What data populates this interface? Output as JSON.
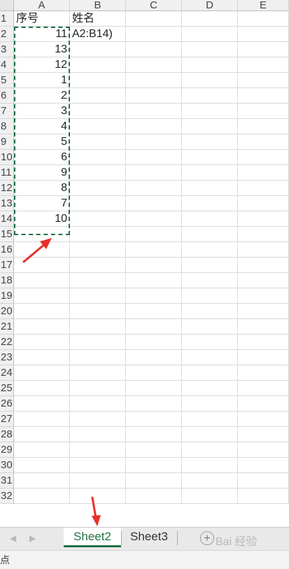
{
  "columns": [
    "A",
    "B",
    "C",
    "D",
    "E"
  ],
  "rows": [
    "1",
    "2",
    "3",
    "4",
    "5",
    "6",
    "7",
    "8",
    "9",
    "10",
    "11",
    "12",
    "13",
    "14",
    "15",
    "16",
    "17",
    "18",
    "19",
    "20",
    "21",
    "22",
    "23",
    "24",
    "25",
    "26",
    "27",
    "28",
    "29",
    "30",
    "31",
    "32"
  ],
  "headers": {
    "A": "序号",
    "B": "姓名"
  },
  "column_a_values": [
    "11",
    "13",
    "12",
    "1",
    "2",
    "3",
    "4",
    "5",
    "6",
    "9",
    "8",
    "7",
    "10"
  ],
  "formula_fragment": "A2:B14)",
  "sheet_tabs": [
    {
      "label": "Sheet2",
      "active": true
    },
    {
      "label": "Sheet3",
      "active": false
    }
  ],
  "add_sheet_glyph": "+",
  "nav_left_glyph": "◀",
  "nav_right_glyph": "▶",
  "watermark": "Bai 经验",
  "status_text": "点",
  "colors": {
    "accent": "#217346",
    "arrow": "#e8302a"
  }
}
